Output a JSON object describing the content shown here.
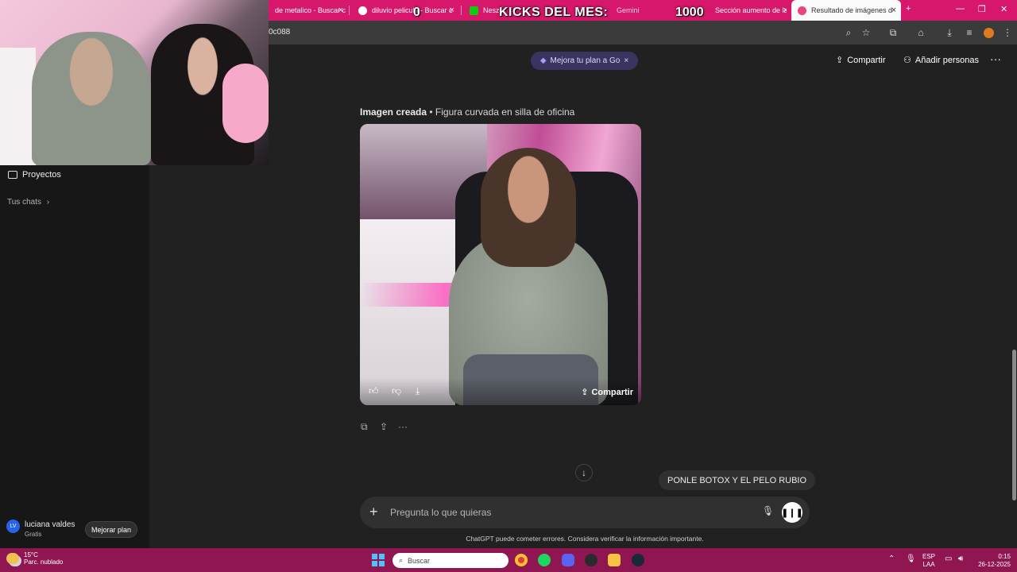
{
  "browser": {
    "tabs": [
      {
        "label": "de metalico - Buscar c"
      },
      {
        "label": "diluvio pelicula - Buscar c"
      },
      {
        "label": "Neszv"
      },
      {
        "label": "Gemini"
      },
      {
        "label": "Sección aumento de labi"
      },
      {
        "label": "Resultado de imágenes d"
      }
    ],
    "new_tab": "+",
    "url": "0c088"
  },
  "overlay": {
    "kicks_title": "KICKS DEL MES:",
    "counter_left": "0",
    "counter_right": "1000"
  },
  "sidebar": {
    "projects_label": "Proyectos",
    "chats_label": "Tus chats",
    "chats_chevron": "›",
    "user": {
      "initials": "LV",
      "name": "luciana valdes",
      "plan": "Gratis"
    },
    "upgrade_label": "Mejorar plan"
  },
  "header": {
    "upgrade_pill": "Mejora tu plan a Go",
    "upgrade_close": "×",
    "share_label": "Compartir",
    "add_people_label": "Añadir personas",
    "more": "···"
  },
  "message": {
    "caption_bold": "Imagen creada",
    "caption_rest": " • Figura curvada en silla de oficina",
    "image_share_label": "Compartir"
  },
  "user_message": "PONLE BOTOX Y EL PELO RUBIO",
  "composer": {
    "placeholder": "Pregunta lo que quieras",
    "plus": "+"
  },
  "disclaimer": "ChatGPT puede cometer errores. Considera verificar la información importante.",
  "taskbar": {
    "weather_temp": "15°C",
    "weather_desc": "Parc. nublado",
    "search_label": "Buscar",
    "lang_top": "ESP",
    "lang_bottom": "LAA",
    "time": "0:15",
    "date": "26-12-2025"
  },
  "colors": {
    "tabbar": "#d6176b",
    "taskbar": "#8f1650",
    "main_bg": "#212121",
    "sidebar_bg": "#171717",
    "accent_pill": "#3a3560"
  }
}
